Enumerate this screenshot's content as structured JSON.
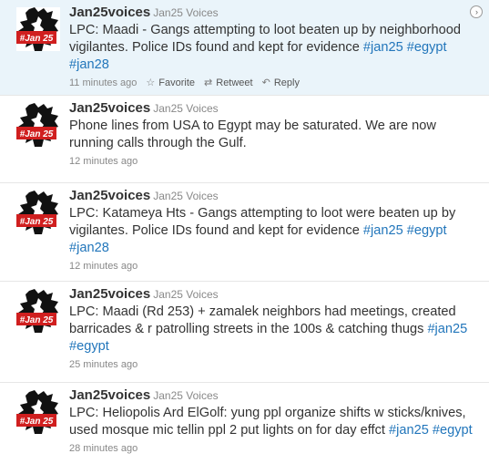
{
  "tweets": [
    {
      "screen_name": "Jan25voices",
      "full_name": "Jan25 Voices",
      "avatar_label": "#Jan 25",
      "parts": [
        {
          "text": "LPC: Maadi - Gangs attempting to loot beaten up by neighborhood vigilantes. Police IDs found and kept for evidence "
        },
        {
          "tag": "#jan25"
        },
        {
          "text": " "
        },
        {
          "tag": "#egypt"
        },
        {
          "text": " "
        },
        {
          "tag": "#jan28"
        }
      ],
      "time": "11 minutes ago",
      "actions": {
        "favorite": "Favorite",
        "retweet": "Retweet",
        "reply": "Reply"
      }
    },
    {
      "screen_name": "Jan25voices",
      "full_name": "Jan25 Voices",
      "avatar_label": "#Jan 25",
      "parts": [
        {
          "text": "Phone lines from USA to Egypt may be saturated. We are now running calls through the Gulf."
        }
      ],
      "time": "12 minutes ago"
    },
    {
      "screen_name": "Jan25voices",
      "full_name": "Jan25 Voices",
      "avatar_label": "#Jan 25",
      "parts": [
        {
          "text": "LPC: Katameya Hts - Gangs attempting to loot were beaten up by vigilantes. Police IDs found and kept for evidence "
        },
        {
          "tag": "#jan25"
        },
        {
          "text": " "
        },
        {
          "tag": "#egypt"
        },
        {
          "text": " "
        },
        {
          "tag": "#jan28"
        }
      ],
      "time": "12 minutes ago"
    },
    {
      "screen_name": "Jan25voices",
      "full_name": "Jan25 Voices",
      "avatar_label": "#Jan 25",
      "parts": [
        {
          "text": "LPC: Maadi (Rd 253) + zamalek neighbors had meetings, created barricades & r patrolling streets in the 100s & catching thugs "
        },
        {
          "tag": "#jan25"
        },
        {
          "text": " "
        },
        {
          "tag": "#egypt"
        }
      ],
      "time": "25 minutes ago"
    },
    {
      "screen_name": "Jan25voices",
      "full_name": "Jan25 Voices",
      "avatar_label": "#Jan 25",
      "parts": [
        {
          "text": "LPC: Heliopolis Ard ElGolf: yung ppl organize shifts w sticks/knives, used mosque mic tellin ppl 2 put lights on for day effct "
        },
        {
          "tag": "#jan25"
        },
        {
          "text": " "
        },
        {
          "tag": "#egypt"
        }
      ],
      "time": "28 minutes ago"
    }
  ],
  "colors": {
    "highlight_bg": "#eaf4fa",
    "hashtag": "#2276bb",
    "avatar_red": "#d01f1f"
  },
  "icons": {
    "favorite": "star-icon",
    "retweet": "retweet-icon",
    "reply": "reply-icon",
    "expand": "chevron-right-icon"
  }
}
